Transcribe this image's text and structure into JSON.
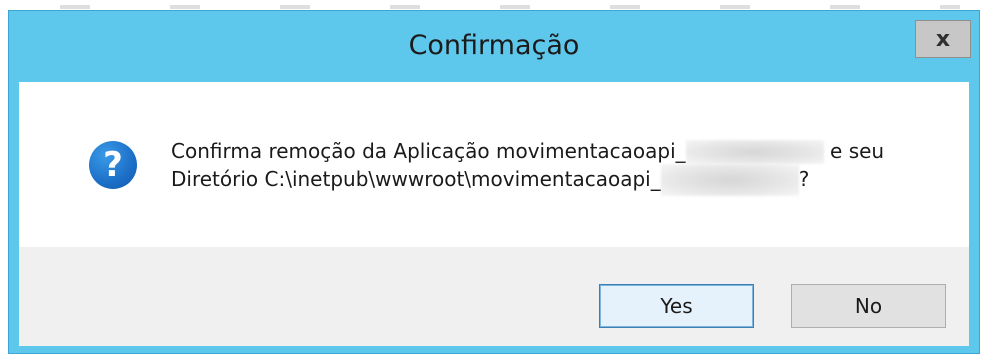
{
  "window": {
    "title": "Confirmação",
    "close_label": "x"
  },
  "message": {
    "line1_prefix": "Confirma remoção da Aplicação movimentacaoapi_",
    "line1_suffix": " e seu",
    "line2_prefix": "Diretório C:\\inetpub\\wwwroot\\movimentacaoapi_",
    "line2_suffix": "?"
  },
  "icon": {
    "name": "question-icon",
    "glyph": "?",
    "color": "#1c6fc7"
  },
  "buttons": {
    "yes_label": "Yes",
    "no_label": "No"
  },
  "colors": {
    "titlebar": "#5ec8ec",
    "footer": "#f0f0f0"
  }
}
